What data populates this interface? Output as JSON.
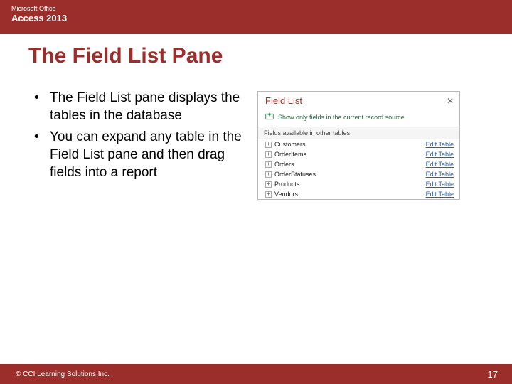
{
  "header": {
    "line1": "Microsoft Office",
    "line2": "Access 2013"
  },
  "title": "The Field List Pane",
  "bullets": [
    "The Field List pane displays the tables in the database",
    "You can expand any table in the Field List pane and then drag fields into a report"
  ],
  "fieldlist": {
    "title": "Field List",
    "close": "✕",
    "showonly": "Show only fields in the current record source",
    "section": "Fields available in other tables:",
    "edit_label": "Edit Table",
    "tables": [
      "Customers",
      "OrderItems",
      "Orders",
      "OrderStatuses",
      "Products",
      "Vendors"
    ]
  },
  "footer": {
    "copyright": "© CCI Learning Solutions Inc.",
    "page": "17"
  }
}
